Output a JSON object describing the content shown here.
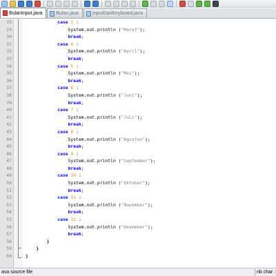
{
  "toolbar": {
    "buttons": [
      "new-file",
      "open-file",
      "save",
      "save-all",
      "close",
      "print",
      "cut",
      "copy",
      "paste",
      "undo",
      "redo",
      "find",
      "replace",
      "zoom-in",
      "zoom-out",
      "sync",
      "wrap",
      "indent-guide",
      "show-all",
      "macro-record",
      "macro-stop",
      "macro-play",
      "macro-play-multi",
      "macro-save"
    ]
  },
  "tabs": [
    {
      "label": "BulanInput.java",
      "active": true
    },
    {
      "label": "Bulan.java",
      "active": false
    },
    {
      "label": "InputDariKeyboard.java",
      "active": false
    }
  ],
  "editor": {
    "lines": [
      {
        "n": "28",
        "code": [
          [
            "t",
            "            "
          ],
          [
            "k",
            "case"
          ],
          [
            "t",
            " "
          ],
          [
            "n",
            "3"
          ],
          [
            "t",
            " :"
          ]
        ]
      },
      {
        "n": "29",
        "code": [
          [
            "t",
            "                System.out.println ("
          ],
          [
            "s",
            "\"Maret\""
          ],
          [
            "t",
            ");"
          ]
        ]
      },
      {
        "n": "30",
        "code": [
          [
            "t",
            "                "
          ],
          [
            "k",
            "break"
          ],
          [
            "t",
            ";"
          ]
        ]
      },
      {
        "n": "31",
        "code": [
          [
            "t",
            "            "
          ],
          [
            "k",
            "case"
          ],
          [
            "t",
            " "
          ],
          [
            "n",
            "4"
          ],
          [
            "t",
            " :"
          ]
        ]
      },
      {
        "n": "32",
        "code": [
          [
            "t",
            "                System.out.println ("
          ],
          [
            "s",
            "\"April\""
          ],
          [
            "t",
            ");"
          ]
        ]
      },
      {
        "n": "33",
        "code": [
          [
            "t",
            "                "
          ],
          [
            "k",
            "break"
          ],
          [
            "t",
            ";"
          ]
        ]
      },
      {
        "n": "34",
        "code": [
          [
            "t",
            "            "
          ],
          [
            "k",
            "case"
          ],
          [
            "t",
            " "
          ],
          [
            "n",
            "5"
          ],
          [
            "t",
            " :"
          ]
        ]
      },
      {
        "n": "35",
        "code": [
          [
            "t",
            "                System.out.println ("
          ],
          [
            "s",
            "\"Mei\""
          ],
          [
            "t",
            ");"
          ]
        ]
      },
      {
        "n": "36",
        "code": [
          [
            "t",
            "                "
          ],
          [
            "k",
            "break"
          ],
          [
            "t",
            ";"
          ]
        ]
      },
      {
        "n": "37",
        "code": [
          [
            "t",
            "            "
          ],
          [
            "k",
            "case"
          ],
          [
            "t",
            " "
          ],
          [
            "n",
            "6"
          ],
          [
            "t",
            " :"
          ]
        ]
      },
      {
        "n": "38",
        "code": [
          [
            "t",
            "                System.out.println ("
          ],
          [
            "s",
            "\"Juni\""
          ],
          [
            "t",
            ");"
          ]
        ]
      },
      {
        "n": "39",
        "code": [
          [
            "t",
            "                "
          ],
          [
            "k",
            "break"
          ],
          [
            "t",
            ";"
          ]
        ]
      },
      {
        "n": "40",
        "code": [
          [
            "t",
            "            "
          ],
          [
            "k",
            "case"
          ],
          [
            "t",
            " "
          ],
          [
            "n",
            "7"
          ],
          [
            "t",
            " :"
          ]
        ]
      },
      {
        "n": "41",
        "code": [
          [
            "t",
            "                System.out.println ("
          ],
          [
            "s",
            "\"Juli\""
          ],
          [
            "t",
            ");"
          ]
        ]
      },
      {
        "n": "42",
        "code": [
          [
            "t",
            "                "
          ],
          [
            "k",
            "break"
          ],
          [
            "t",
            ";"
          ]
        ]
      },
      {
        "n": "43",
        "code": [
          [
            "t",
            "            "
          ],
          [
            "k",
            "case"
          ],
          [
            "t",
            " "
          ],
          [
            "n",
            "8"
          ],
          [
            "t",
            " :"
          ]
        ]
      },
      {
        "n": "44",
        "code": [
          [
            "t",
            "                System.out.println ("
          ],
          [
            "s",
            "\"Agustus\""
          ],
          [
            "t",
            ");"
          ]
        ]
      },
      {
        "n": "45",
        "code": [
          [
            "t",
            "                "
          ],
          [
            "k",
            "break"
          ],
          [
            "t",
            ";"
          ]
        ]
      },
      {
        "n": "46",
        "code": [
          [
            "t",
            "            "
          ],
          [
            "k",
            "case"
          ],
          [
            "t",
            " "
          ],
          [
            "n",
            "9"
          ],
          [
            "t",
            " :"
          ]
        ]
      },
      {
        "n": "47",
        "code": [
          [
            "t",
            "                System.out.println ("
          ],
          [
            "s",
            "\"September\""
          ],
          [
            "t",
            ");"
          ]
        ]
      },
      {
        "n": "48",
        "code": [
          [
            "t",
            "                "
          ],
          [
            "k",
            "break"
          ],
          [
            "t",
            ";"
          ]
        ]
      },
      {
        "n": "49",
        "code": [
          [
            "t",
            "            "
          ],
          [
            "k",
            "case"
          ],
          [
            "t",
            " "
          ],
          [
            "n",
            "10"
          ],
          [
            "t",
            " :"
          ]
        ]
      },
      {
        "n": "50",
        "code": [
          [
            "t",
            "                System.out.println ("
          ],
          [
            "s",
            "\"Oktober\""
          ],
          [
            "t",
            ");"
          ]
        ]
      },
      {
        "n": "51",
        "code": [
          [
            "t",
            "                "
          ],
          [
            "k",
            "break"
          ],
          [
            "t",
            ";"
          ]
        ]
      },
      {
        "n": "52",
        "code": [
          [
            "t",
            "            "
          ],
          [
            "k",
            "case"
          ],
          [
            "t",
            " "
          ],
          [
            "n",
            "11"
          ],
          [
            "t",
            " :"
          ]
        ]
      },
      {
        "n": "53",
        "code": [
          [
            "t",
            "                System.out.println ("
          ],
          [
            "s",
            "\"Nopember\""
          ],
          [
            "t",
            ");"
          ]
        ]
      },
      {
        "n": "54",
        "code": [
          [
            "t",
            "                "
          ],
          [
            "k",
            "break"
          ],
          [
            "t",
            ";"
          ]
        ]
      },
      {
        "n": "55",
        "code": [
          [
            "t",
            "            "
          ],
          [
            "k",
            "case"
          ],
          [
            "t",
            " "
          ],
          [
            "n",
            "12"
          ],
          [
            "t",
            " :"
          ]
        ]
      },
      {
        "n": "56",
        "code": [
          [
            "t",
            "                System.out.println ("
          ],
          [
            "s",
            "\"Desember\""
          ],
          [
            "t",
            ");"
          ]
        ]
      },
      {
        "n": "57",
        "code": [
          [
            "t",
            "                "
          ],
          [
            "k",
            "break"
          ],
          [
            "t",
            ";"
          ]
        ]
      },
      {
        "n": "58",
        "code": [
          [
            "t",
            "        "
          ],
          [
            "o",
            "}"
          ]
        ]
      },
      {
        "n": "59",
        "code": [
          [
            "t",
            "    "
          ],
          [
            "o",
            "}"
          ]
        ]
      },
      {
        "n": "60",
        "code": [
          [
            "o",
            "}"
          ]
        ]
      }
    ]
  },
  "statusbar": {
    "left": "ava source file",
    "right": "nb char :"
  },
  "colors": {
    "keyword": "#0000ff",
    "number": "#ff8000",
    "string": "#808080",
    "operator": "#000080"
  }
}
